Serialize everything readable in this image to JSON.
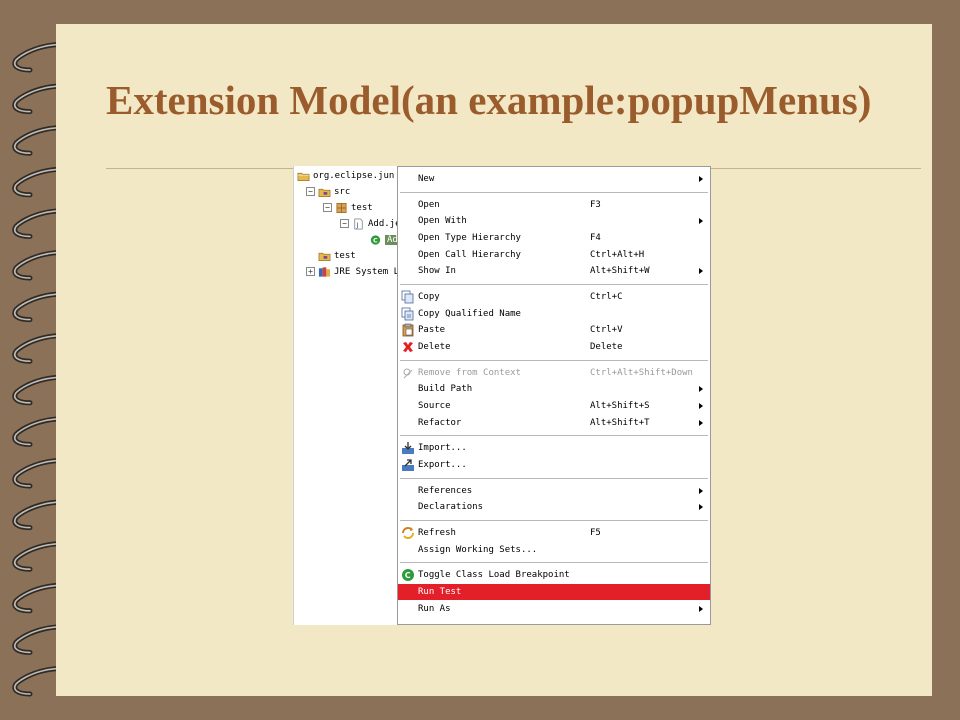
{
  "slide": {
    "title": "Extension Model(an example:popupMenus)"
  },
  "tree": [
    {
      "label": "org.eclipse.jun",
      "level": 0,
      "expander": "",
      "icon": "project-icon"
    },
    {
      "label": "src",
      "level": 1,
      "expander": "−",
      "icon": "source-folder-icon"
    },
    {
      "label": "test",
      "level": 2,
      "expander": "−",
      "icon": "package-icon"
    },
    {
      "label": "Add.je",
      "level": 3,
      "expander": "−",
      "icon": "java-file-icon"
    },
    {
      "label": "Add",
      "level": 4,
      "expander": "",
      "icon": "class-icon",
      "selected": true
    },
    {
      "label": "test",
      "level": 1,
      "expander": "",
      "icon": "source-folder-icon"
    },
    {
      "label": "JRE System L",
      "level": 1,
      "expander": "+",
      "icon": "library-icon"
    }
  ],
  "menu": {
    "groups": [
      [
        {
          "label": "New",
          "submenu": true
        }
      ],
      [
        {
          "label": "Open",
          "shortcut": "F3"
        },
        {
          "label": "Open With",
          "submenu": true
        },
        {
          "label": "Open Type Hierarchy",
          "shortcut": "F4"
        },
        {
          "label": "Open Call Hierarchy",
          "shortcut": "Ctrl+Alt+H"
        },
        {
          "label": "Show In",
          "shortcut": "Alt+Shift+W",
          "submenu": true
        }
      ],
      [
        {
          "label": "Copy",
          "shortcut": "Ctrl+C",
          "icon": "copy-icon"
        },
        {
          "label": "Copy Qualified Name",
          "icon": "copy-qualified-icon"
        },
        {
          "label": "Paste",
          "shortcut": "Ctrl+V",
          "icon": "paste-icon"
        },
        {
          "label": "Delete",
          "shortcut": "Delete",
          "icon": "delete-icon"
        }
      ],
      [
        {
          "label": "Remove from Context",
          "shortcut": "Ctrl+Alt+Shift+Down",
          "icon": "remove-context-icon",
          "disabled": true
        },
        {
          "label": "Build Path",
          "submenu": true
        },
        {
          "label": "Source",
          "shortcut": "Alt+Shift+S",
          "submenu": true
        },
        {
          "label": "Refactor",
          "shortcut": "Alt+Shift+T",
          "submenu": true
        }
      ],
      [
        {
          "label": "Import...",
          "icon": "import-icon"
        },
        {
          "label": "Export...",
          "icon": "export-icon"
        }
      ],
      [
        {
          "label": "References",
          "submenu": true
        },
        {
          "label": "Declarations",
          "submenu": true
        }
      ],
      [
        {
          "label": "Refresh",
          "shortcut": "F5",
          "icon": "refresh-icon"
        },
        {
          "label": "Assign Working Sets..."
        }
      ],
      [
        {
          "label": "Toggle Class Load Breakpoint",
          "icon": "breakpoint-icon"
        },
        {
          "label": "Run Test",
          "active": true
        },
        {
          "label": "Run As",
          "submenu": true
        }
      ]
    ]
  },
  "colors": {
    "highlight": "#e3202a",
    "title": "#9a5c2c",
    "paper": "#f3e8c6",
    "frame": "#8b7158"
  }
}
